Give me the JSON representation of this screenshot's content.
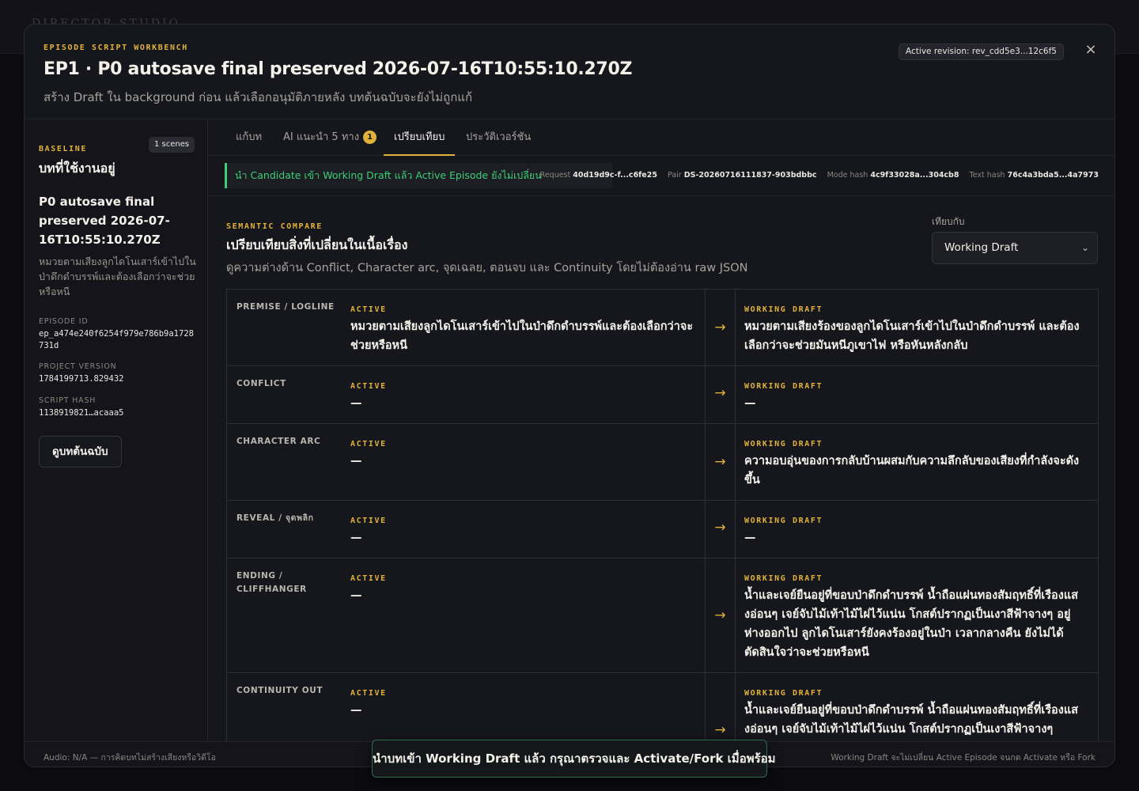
{
  "backdrop": {
    "app_title": "DIRECTOR STUDIO"
  },
  "header": {
    "eyebrow": "EPISODE SCRIPT WORKBENCH",
    "title": "EP1 · P0 autosave final preserved 2026-07-16T10:55:10.270Z",
    "subtitle": "สร้าง Draft ใน background ก่อน แล้วเลือกอนุมัติภายหลัง บทต้นฉบับจะยังไม่ถูกแก้",
    "revision_label": "Active revision: rev_cdd5e3...12c6f5",
    "close_icon": "×"
  },
  "sidebar": {
    "eyebrow": "BASELINE",
    "badge": "1 scenes",
    "heading": "บทที่ใช้งานอยู่",
    "title": "P0 autosave final preserved 2026-07-16T10:55:10.270Z",
    "description": "หมวยตามเสียงลูกไดโนเสาร์เข้าไปในป่าดึกดำบรรพ์และต้องเลือกว่าจะช่วยหรือหนี",
    "meta": [
      {
        "label": "EPISODE ID",
        "value": "ep_a474e240f6254f979e786b9a1728731d"
      },
      {
        "label": "PROJECT VERSION",
        "value": "1784199713.829432"
      },
      {
        "label": "SCRIPT HASH",
        "value": "1138919821…acaaa5"
      }
    ],
    "view_button": "ดูบทต้นฉบับ"
  },
  "tabs": [
    {
      "label": "แก้บท"
    },
    {
      "label": "AI แนะนำ 5 ทาง",
      "count": "1"
    },
    {
      "label": "เปรียบเทียบ"
    },
    {
      "label": "ประวัติเวอร์ชัน"
    }
  ],
  "status": {
    "banner": "นำ Candidate เข้า Working Draft แล้ว Active Episode ยังไม่เปลี่ยน",
    "hashes": [
      {
        "label": "Request",
        "value": "40d19d9c-f...c6fe25"
      },
      {
        "label": "Pair",
        "value": "DS-20260716111837-903bdbbc"
      },
      {
        "label": "Mode hash",
        "value": "4c9f33028a...304cb8"
      },
      {
        "label": "Text hash",
        "value": "76c4a3bda5...4a7973"
      }
    ]
  },
  "semantic": {
    "eyebrow": "SEMANTIC COMPARE",
    "title": "เปรียบเทียบสิ่งที่เปลี่ยนในเนื้อเรื่อง",
    "description": "ดูความต่างด้าน Conflict, Character arc, จุดเฉลย, ตอนจบ และ Continuity โดยไม่ต้องอ่าน raw JSON",
    "compare_label": "เทียบกับ",
    "compare_value": "Working Draft",
    "active_tag": "ACTIVE",
    "draft_tag": "WORKING DRAFT",
    "arrow": "→",
    "rows": [
      {
        "label": "PREMISE / LOGLINE",
        "active": "หมวยตามเสียงลูกไดโนเสาร์เข้าไปในป่าดึกดำบรรพ์และต้องเลือกว่าจะช่วยหรือหนี",
        "draft": "หมวยตามเสียงร้องของลูกไดโนเสาร์เข้าไปในป่าดึกดำบรรพ์ และต้องเลือกว่าจะช่วยมันหนีภูเขาไฟ หรือหันหลังกลับ"
      },
      {
        "label": "CONFLICT",
        "active": "—",
        "draft": "—"
      },
      {
        "label": "CHARACTER ARC",
        "active": "—",
        "draft": "ความอบอุ่นของการกลับบ้านผสมกับความลึกลับของเสียงที่กำลังจะดังขึ้น"
      },
      {
        "label": "REVEAL / จุดพลิก",
        "active": "—",
        "draft": "—"
      },
      {
        "label": "ENDING / CLIFFHANGER",
        "active": "—",
        "draft": "น้ำและเจย์ยืนอยู่ที่ขอบป่าดึกดำบรรพ์ น้ำถือแผ่นทองสัมฤทธิ์ที่เรืองแสงอ่อนๆ เจย์จับไม้เท้าไม้ไผ่ไว้แน่น โกสต์ปรากฏเป็นเงาสีฟ้าจางๆ อยู่ห่างออกไป ลูกไดโนเสาร์ยังคงร้องอยู่ในป่า เวลากลางคืน ยังไม่ได้ตัดสินใจว่าจะช่วยหรือหนี"
      },
      {
        "label": "CONTINUITY OUT",
        "active": "—",
        "draft": "น้ำและเจย์ยืนอยู่ที่ขอบป่าดึกดำบรรพ์ น้ำถือแผ่นทองสัมฤทธิ์ที่เรืองแสงอ่อนๆ เจย์จับไม้เท้าไม้ไผ่ไว้แน่น โกสต์ปรากฏเป็นเงาสีฟ้าจางๆ"
      }
    ]
  },
  "footer": {
    "left": "Audio: N/A — การคิดบทไม่สร้างเสียงหรือวิดีโอ",
    "right": "Working Draft จะไม่เปลี่ยน Active Episode จนกด Activate หรือ Fork"
  },
  "toast": "นำบทเข้า Working Draft แล้ว กรุณาตรวจและ Activate/Fork เมื่อพร้อม",
  "colors": {
    "accent": "#e0b23c",
    "success": "#3ccf78",
    "background": "#16161d"
  }
}
